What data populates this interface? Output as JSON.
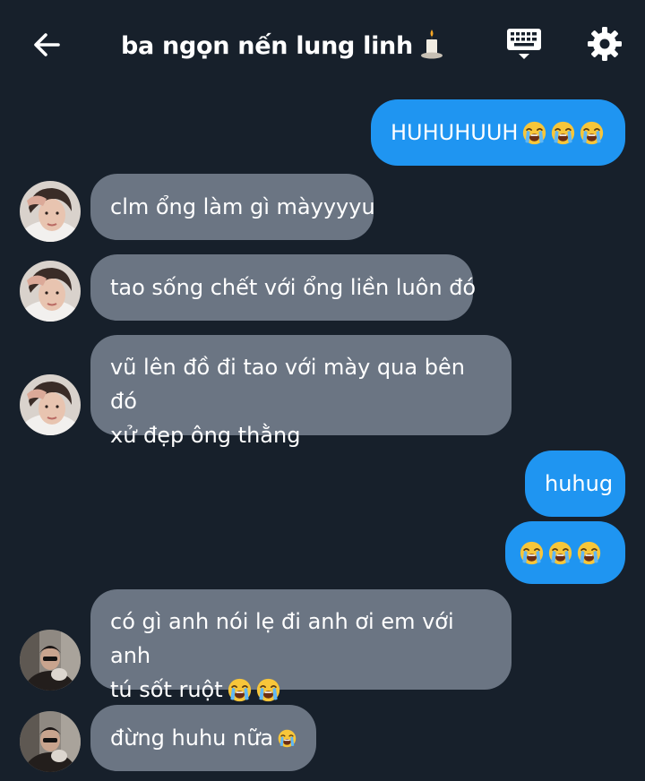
{
  "header": {
    "title": "ba ngọn nến lung linh",
    "back_icon": "arrow-left-icon",
    "keyboard_icon": "keyboard-icon",
    "settings_icon": "gear-icon",
    "title_emoji": "candle-icon"
  },
  "colors": {
    "background": "#17202b",
    "incoming_bubble": "#6b7583",
    "outgoing_bubble": "#1f95f1",
    "text": "#ffffff"
  },
  "messages": [
    {
      "direction": "out",
      "text": "HUHUHUUH",
      "emoji_count": 3
    },
    {
      "direction": "in",
      "text": "clm ổng làm gì màyyyyu",
      "avatar": "avatar-1"
    },
    {
      "direction": "in",
      "text": "tao sống chết với ổng liền luôn đó",
      "avatar": "avatar-1"
    },
    {
      "direction": "in",
      "text_line1": "vũ lên đồ đi tao với mày qua bên đó",
      "text_line2": "xử đẹp ông thằng",
      "avatar": "avatar-1"
    },
    {
      "direction": "out",
      "text": "huhug"
    },
    {
      "direction": "out",
      "text": "",
      "emoji_count": 3
    },
    {
      "direction": "in",
      "text_line1": "có gì anh nói lẹ đi anh ơi em với anh",
      "text_line2": "tú sốt ruột",
      "emoji_count": 2,
      "avatar": "avatar-2"
    },
    {
      "direction": "in",
      "text": "đừng huhu nữa",
      "emoji_count": 1,
      "avatar": "avatar-2"
    }
  ]
}
